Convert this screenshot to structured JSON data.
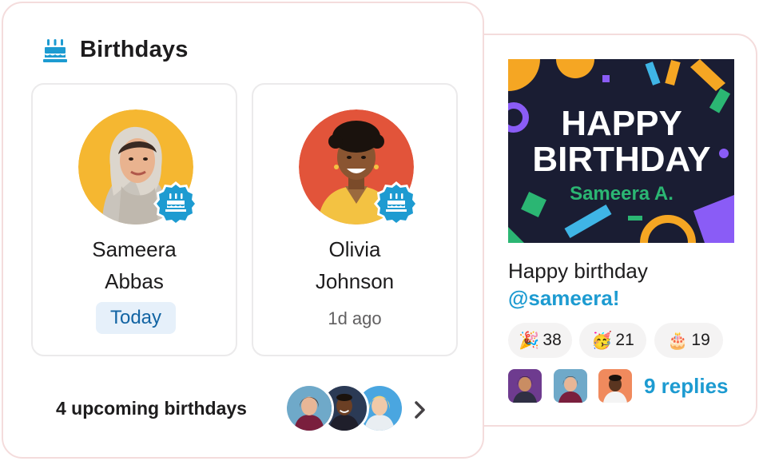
{
  "birthdays": {
    "title": "Birthdays",
    "people": [
      {
        "first_name": "Sameera",
        "last_name": "Abbas",
        "status": "Today"
      },
      {
        "first_name": "Olivia",
        "last_name": "Johnson",
        "status": "1d ago"
      }
    ],
    "upcoming_label": "4 upcoming birthdays"
  },
  "message": {
    "banner": {
      "line1": "HAPPY",
      "line2": "BIRTHDAY",
      "line3": "Sameera A."
    },
    "text": "Happy birthday",
    "mention": "@sameera!",
    "reactions": [
      {
        "emoji": "🎉",
        "count": "38"
      },
      {
        "emoji": "🥳",
        "count": "21"
      },
      {
        "emoji": "🎂",
        "count": "19"
      }
    ],
    "replies_label": "9 replies"
  },
  "colors": {
    "accent_blue": "#1d9bd1",
    "today_bg": "#e6f0fa",
    "today_text": "#1264a3",
    "panel_border": "#f4dcdc",
    "banner_bg": "#1a1d33",
    "banner_green": "#2bb673"
  }
}
